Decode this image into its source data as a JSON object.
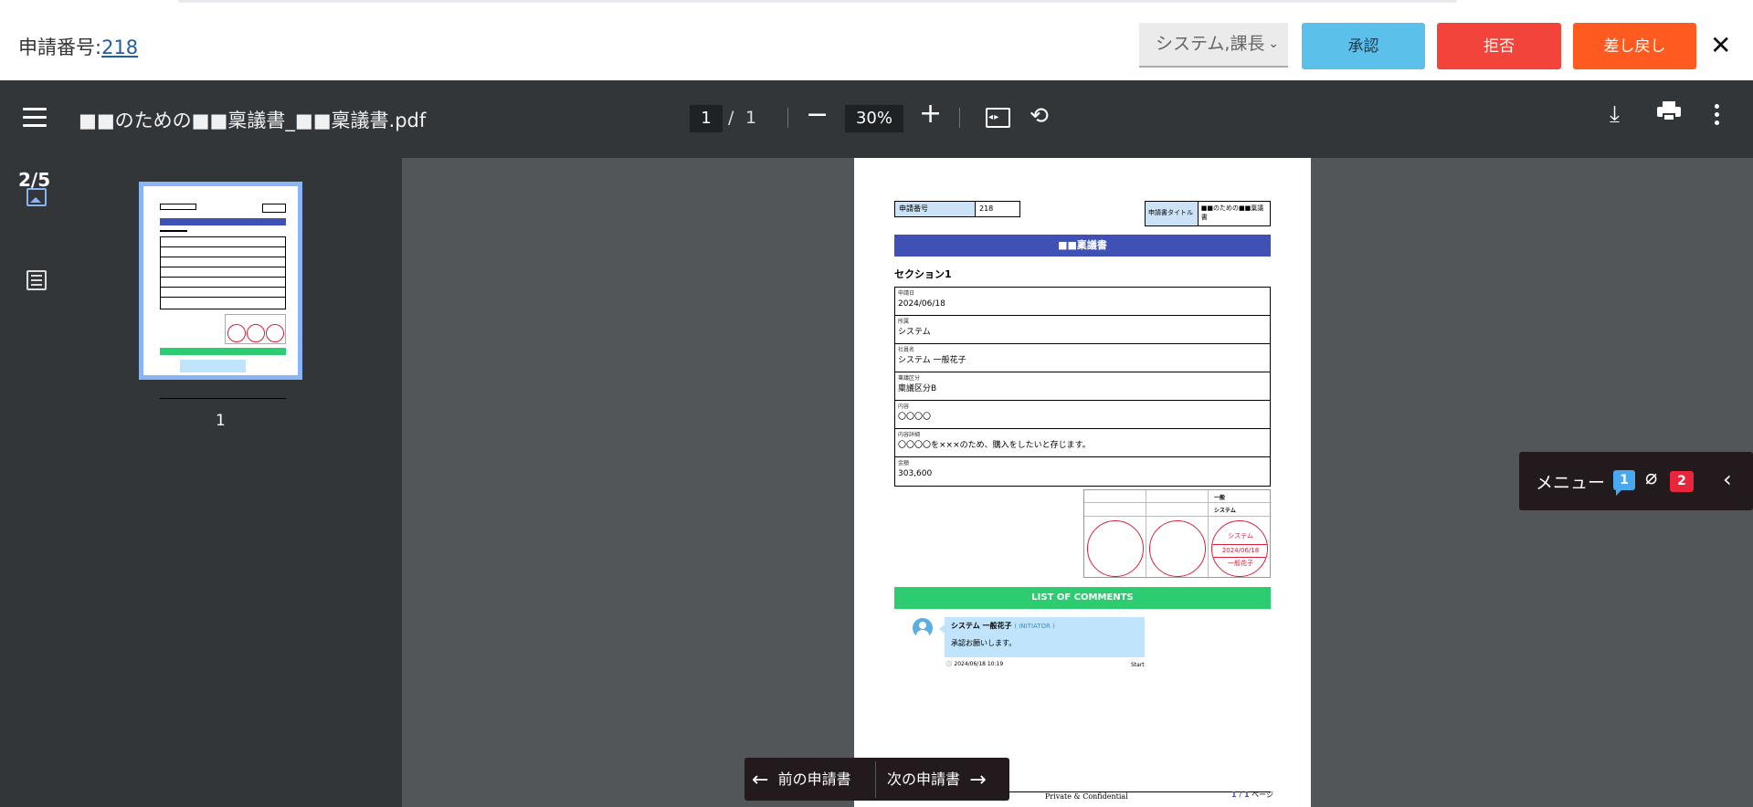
{
  "header": {
    "application_label": "申請番号:",
    "application_number": "218",
    "approver_select": "システム,課長",
    "approve_label": "承認",
    "reject_label": "拒否",
    "return_label": "差し戻し",
    "close_symbol": "✕"
  },
  "viewer": {
    "file_name": "■■のための■■稟議書_■■稟議書.pdf",
    "current_page": "1",
    "page_separator": "/",
    "total_pages": "1",
    "zoom": "30%",
    "zoom_out_symbol": "−",
    "zoom_in_symbol": "+",
    "rotate_symbol": "⟲",
    "download_symbol": "⤓"
  },
  "sidebar": {
    "counter": "2/5",
    "thumbnail_label": "1"
  },
  "document": {
    "meta_no_label": "申請番号",
    "meta_no_value": "218",
    "meta_title_label": "申請書タイトル",
    "meta_title_value": "■■のための■■稟議書",
    "banner": "■■稟議書",
    "section": "セクション1",
    "rows": [
      {
        "label": "申請日",
        "value": "2024/06/18"
      },
      {
        "label": "所属",
        "value": "システム"
      },
      {
        "label": "社員名",
        "value": "システム 一般花子"
      },
      {
        "label": "稟議区分",
        "value": "稟議区分B"
      },
      {
        "label": "内容",
        "value": "〇〇〇〇"
      },
      {
        "label": "内容詳細",
        "value": "〇〇〇〇を×××のため、購入をしたいと存じます。"
      },
      {
        "label": "金額",
        "value": "303,600"
      }
    ],
    "stamp_header_1": "一般",
    "stamp_header_2": "システム",
    "seal_line1": "システム",
    "seal_line2": "2024/06/18",
    "seal_line3": "一般花子",
    "comments_banner": "LIST OF COMMENTS",
    "comment_author": "システム 一般花子",
    "comment_role": "( INITIATOR )",
    "comment_message": "承認お願いします。",
    "comment_time": "🕓 2024/06/18 10:19",
    "comment_step": "Start",
    "footer_text": "Private & Confidential",
    "footer_page_num": "1 / 1",
    "footer_page_suffix": " ページ"
  },
  "float_menu": {
    "label": "メニュー",
    "comment_count": "1",
    "attachment_count": "2",
    "clip_symbol": "⌀",
    "collapse_symbol": "‹"
  },
  "nav": {
    "prev_label": "前の申請書",
    "next_label": "次の申請書",
    "prev_arrow": "←",
    "next_arrow": "→"
  }
}
